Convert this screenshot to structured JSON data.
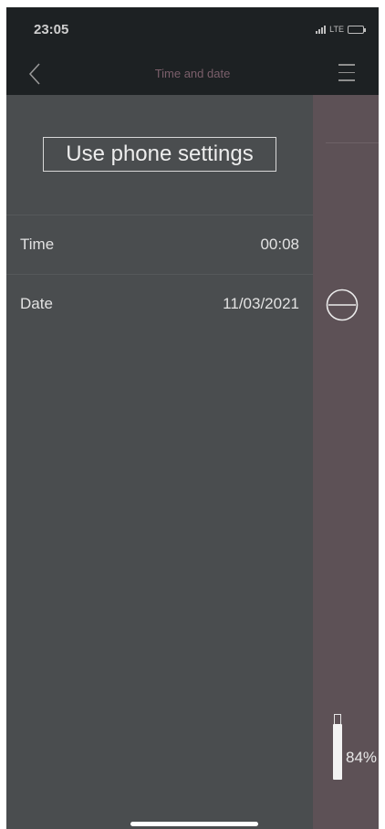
{
  "status_bar": {
    "time": "23:05",
    "network": "LTE",
    "battery_level": 0.8
  },
  "nav": {
    "title": "Time and date",
    "back_icon": "chevron-left-icon",
    "menu_icon": "hamburger-menu-icon"
  },
  "settings": {
    "use_phone_label": "Use phone settings",
    "rows": [
      {
        "label": "Time",
        "value": "00:08"
      },
      {
        "label": "Date",
        "value": "11/03/2021"
      }
    ]
  },
  "side": {
    "action_icon": "minus-circle-icon",
    "battery_percent": "84%"
  },
  "colors": {
    "background": "#1d2123",
    "panel": "#4a4d4f",
    "side_panel": "#5d5156",
    "nav_title": "#7b5f6b"
  }
}
